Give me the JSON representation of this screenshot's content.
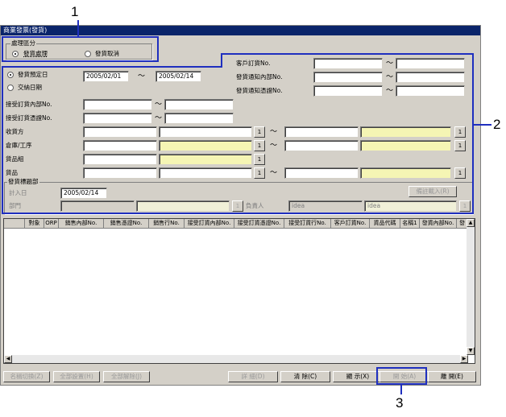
{
  "window": {
    "title": "商業發票(發貨)"
  },
  "process_group": {
    "title": "處理區分",
    "options": [
      {
        "label": "發貨處理",
        "selected": true
      },
      {
        "label": "發貨取消",
        "selected": false
      }
    ]
  },
  "date_options": [
    {
      "label": "發貨預定日",
      "selected": true
    },
    {
      "label": "交納日期",
      "selected": false
    }
  ],
  "date_from": "2005/02/01",
  "date_to": "2005/02/14",
  "tilde": "～",
  "right_fields": [
    {
      "label": "客戶訂貨No."
    },
    {
      "label": "發貨通知內部No."
    },
    {
      "label": "發貨通知憑證No."
    }
  ],
  "left_fields": [
    {
      "label": "接受訂貨內部No."
    },
    {
      "label": "接受訂貨憑證No."
    }
  ],
  "lookup_fields": [
    {
      "label": "收貨方"
    },
    {
      "label": "倉庫/工序"
    },
    {
      "label": "貨品組"
    },
    {
      "label": "貨品"
    }
  ],
  "lookup_button": "1",
  "header_section": {
    "title": "發貨標題部",
    "entry_date_label": "計入日",
    "entry_date": "2005/02/14",
    "dept_label": "部門",
    "owner_label": "負責人",
    "owner_code": "idea",
    "owner_name": "idea",
    "memo_button": "備註載入(R)"
  },
  "grid": {
    "columns": [
      "",
      "對象",
      "ORP",
      "銷售內部No.",
      "銷售憑證No.",
      "銷售行No.",
      "接受訂貨內部No.",
      "接受訂貨憑證No.",
      "接受訂貨行No.",
      "客戶訂貨No.",
      "貨品代碼",
      "名稱1",
      "發貨內部No.",
      "發"
    ]
  },
  "bottom_buttons": {
    "toggle_name": "名稱切換(Z)",
    "select_all": "全部設置(H)",
    "clear_all": "全部解除(J)",
    "detail": "詳 細(D)",
    "clear": "清 除(C)",
    "display": "顯 示(X)",
    "register": "開 始(A)",
    "close": "離 開(E)"
  },
  "callouts": [
    "1",
    "2",
    "3"
  ]
}
